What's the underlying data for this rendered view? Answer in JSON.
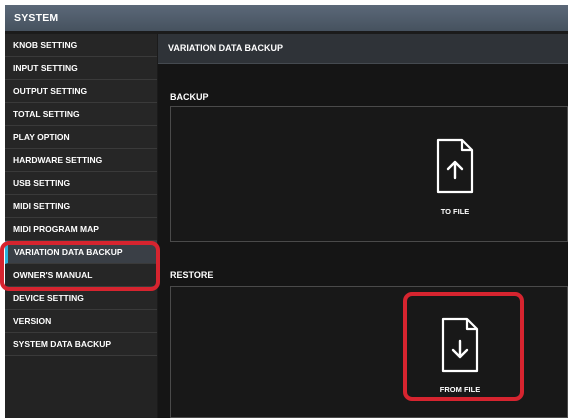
{
  "window": {
    "title": "SYSTEM"
  },
  "sidebar": {
    "items": [
      {
        "label": "KNOB SETTING",
        "name": "sidebar-item-knob-setting"
      },
      {
        "label": "INPUT SETTING",
        "name": "sidebar-item-input-setting"
      },
      {
        "label": "OUTPUT SETTING",
        "name": "sidebar-item-output-setting"
      },
      {
        "label": "TOTAL SETTING",
        "name": "sidebar-item-total-setting"
      },
      {
        "label": "PLAY OPTION",
        "name": "sidebar-item-play-option"
      },
      {
        "label": "HARDWARE SETTING",
        "name": "sidebar-item-hardware-setting"
      },
      {
        "label": "USB SETTING",
        "name": "sidebar-item-usb-setting"
      },
      {
        "label": "MIDI SETTING",
        "name": "sidebar-item-midi-setting"
      },
      {
        "label": "MIDI PROGRAM MAP",
        "name": "sidebar-item-midi-program-map"
      },
      {
        "label": "VARIATION DATA BACKUP",
        "name": "sidebar-item-variation-data-backup"
      },
      {
        "label": "OWNER'S MANUAL",
        "name": "sidebar-item-owners-manual"
      },
      {
        "label": "DEVICE SETTING",
        "name": "sidebar-item-device-setting"
      },
      {
        "label": "VERSION",
        "name": "sidebar-item-version"
      },
      {
        "label": "SYSTEM DATA BACKUP",
        "name": "sidebar-item-system-data-backup"
      }
    ],
    "active_index": 9
  },
  "main": {
    "header": "VARIATION DATA BACKUP",
    "backup": {
      "label": "BACKUP",
      "button_label": "TO FILE",
      "icon": "file-upload-icon"
    },
    "restore": {
      "label": "RESTORE",
      "button_label": "FROM FILE",
      "icon": "file-download-icon"
    }
  },
  "colors": {
    "highlight": "#d6242f",
    "active_accent": "#2bb0d8",
    "background": "#1b1b1b"
  }
}
